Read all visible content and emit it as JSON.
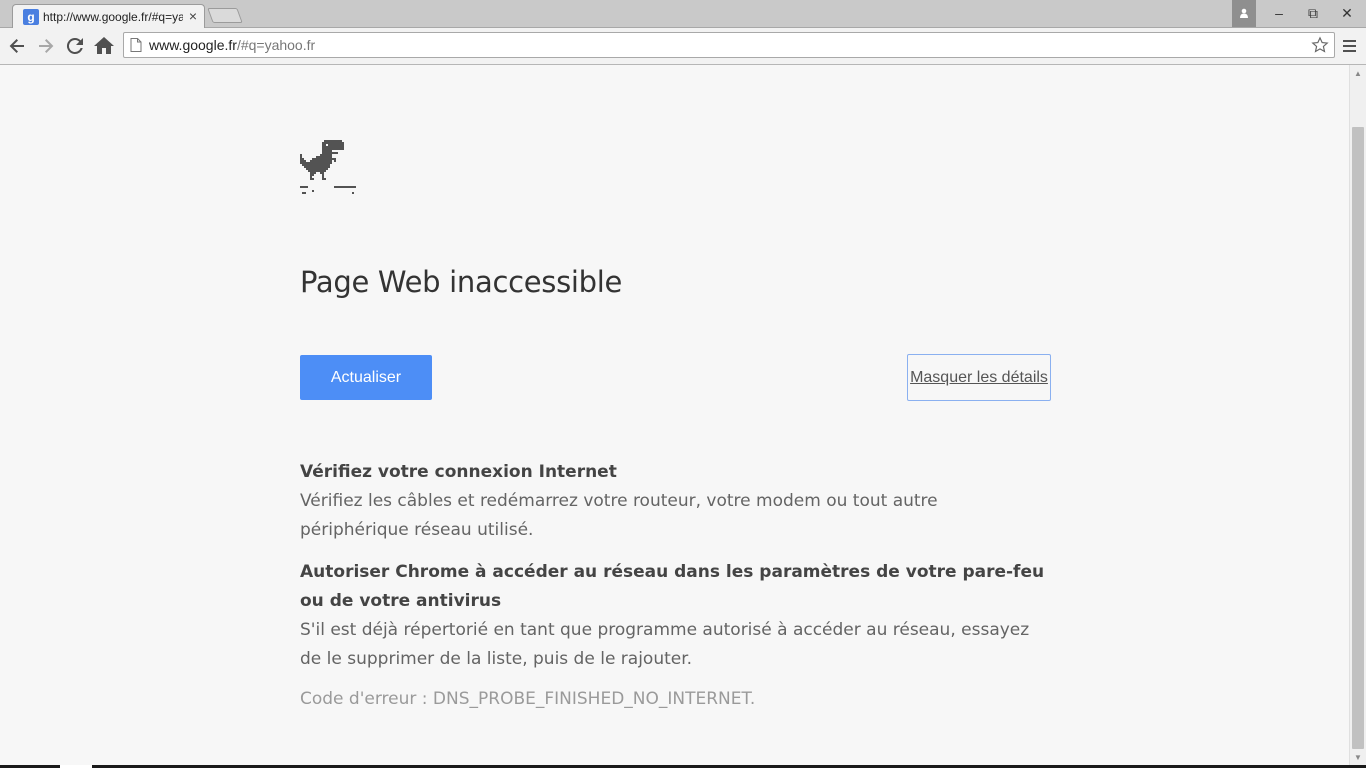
{
  "browser": {
    "tab": {
      "favicon_letter": "g",
      "title": "http://www.google.fr/#q=yahoo.fr",
      "close_glyph": "×"
    },
    "window_controls": {
      "minimize": "–",
      "maximize": "⧉",
      "close": "✕"
    },
    "omnibox": {
      "host": "www.google.fr",
      "path": "/#q=yahoo.fr"
    },
    "icons": {
      "back": "back-arrow-icon",
      "forward": "forward-arrow-icon",
      "reload": "reload-icon",
      "home": "home-icon",
      "bookmark": "star-icon",
      "menu": "hamburger-menu-icon",
      "profile": "person-icon"
    }
  },
  "error_page": {
    "headline": "Page Web inaccessible",
    "reload_label": "Actualiser",
    "details_label": "Masquer les détails",
    "suggestions": [
      {
        "title": "Vérifiez votre connexion Internet",
        "body": "Vérifiez les câbles et redémarrez votre routeur, votre modem ou tout autre périphérique réseau utilisé."
      },
      {
        "title": "Autoriser Chrome à accéder au réseau dans les paramètres de votre pare-feu ou de votre antivirus",
        "body": "S'il est déjà répertorié en tant que programme autorisé à accéder au réseau, essayez de le supprimer de la liste, puis de le rajouter."
      }
    ],
    "error_code": "Code d'erreur : DNS_PROBE_FINISHED_NO_INTERNET."
  },
  "colors": {
    "accent_button": "#4d8ef6",
    "page_background": "#f7f7f7",
    "text": "#646464"
  }
}
